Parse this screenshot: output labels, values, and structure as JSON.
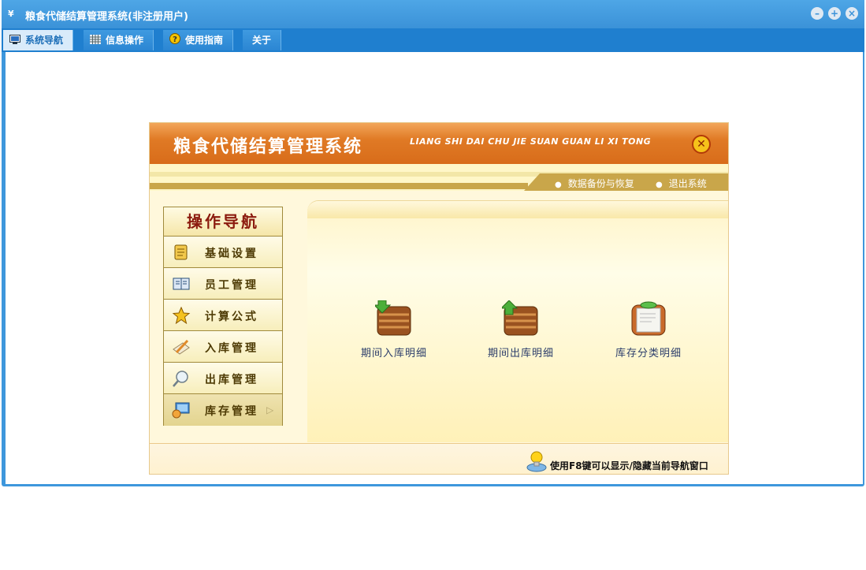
{
  "window": {
    "title": "粮食代储结算管理系统(非注册用户)",
    "app_icon_text": "¥"
  },
  "menu": {
    "tabs": [
      {
        "label": "系统导航",
        "active": true
      },
      {
        "label": "信息操作",
        "active": false
      },
      {
        "label": "使用指南",
        "active": false
      },
      {
        "label": "关于",
        "active": false
      }
    ]
  },
  "panel": {
    "title": "粮食代储结算管理系统",
    "subtitle": "LIANG SHI DAI CHU JIE SUAN GUAN LI XI TONG",
    "links": [
      "数据备份与恢复",
      "退出系统"
    ],
    "nav": {
      "header": "操作导航",
      "items": [
        {
          "label": "基础设置",
          "icon": "scroll-icon"
        },
        {
          "label": "员工管理",
          "icon": "book-icon"
        },
        {
          "label": "计算公式",
          "icon": "star-icon"
        },
        {
          "label": "入库管理",
          "icon": "pencil-icon"
        },
        {
          "label": "出库管理",
          "icon": "magnifier-icon"
        },
        {
          "label": "库存管理",
          "icon": "computer-icon",
          "selected": true
        }
      ]
    },
    "tiles": [
      {
        "label": "期间入库明细",
        "icon": "box-in-icon"
      },
      {
        "label": "期间出库明细",
        "icon": "box-out-icon"
      },
      {
        "label": "库存分类明细",
        "icon": "clipboard-icon"
      }
    ],
    "hint": "使用F8键可以显示/隐藏当前导航窗口"
  },
  "colors": {
    "window_blue": "#3e97dc",
    "menubar_blue": "#1f7fcf",
    "banner_orange": "#e07a25",
    "nav_header_red": "#8b1a0e",
    "tile_text": "#2c3e6b"
  }
}
